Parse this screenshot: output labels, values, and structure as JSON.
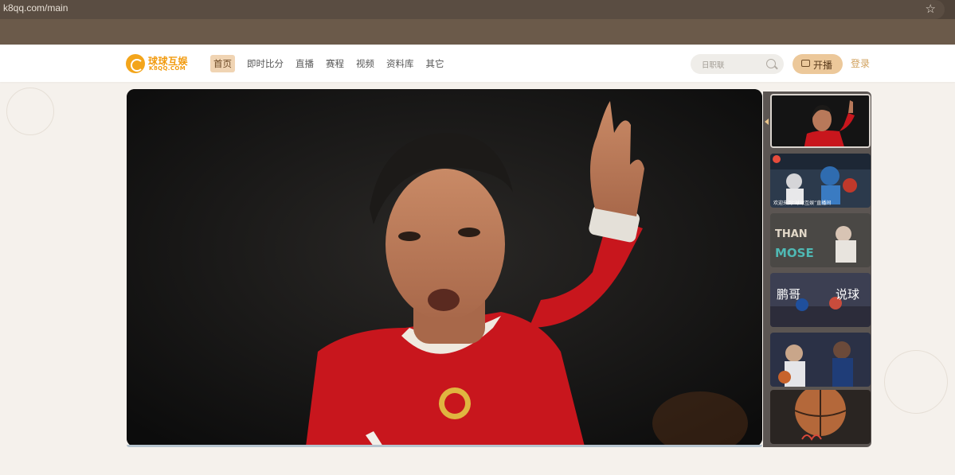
{
  "browser": {
    "url": "k8qq.com/main",
    "bookmark_icon": "star-icon"
  },
  "header": {
    "logo_text": "球球互娱",
    "logo_sub": "K8QQ.COM",
    "nav": [
      {
        "label": "首页",
        "active": true
      },
      {
        "label": "即时比分"
      },
      {
        "label": "直播"
      },
      {
        "label": "赛程"
      },
      {
        "label": "视频"
      },
      {
        "label": "资料库"
      },
      {
        "label": "其它"
      }
    ],
    "search_placeholder": "日职联",
    "broadcast_label": "开播",
    "login_label": "登录"
  },
  "colors": {
    "accent": "#f29b0f",
    "nav_active_bg": "#f0d4b3",
    "broadcast_bg": "#ecc89a",
    "login": "#d1a15c"
  },
  "hero": {
    "jersey_color": "#c8161d"
  },
  "thumbnails": [
    {
      "text": "",
      "active": true
    },
    {
      "text": "欢迎来到“球球互娱”直播间"
    },
    {
      "text": "THAN MOSE"
    },
    {
      "text": "鹏哥 说球"
    },
    {
      "text": ""
    },
    {
      "text": ""
    }
  ]
}
